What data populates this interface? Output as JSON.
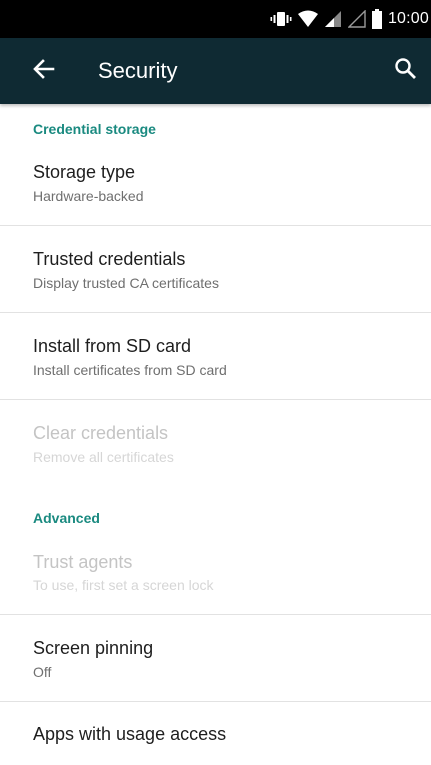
{
  "status_bar": {
    "time": "10:00",
    "icons": [
      "vibrate-icon",
      "wifi-icon",
      "signal-icon",
      "signal-empty-icon",
      "battery-icon"
    ]
  },
  "app_bar": {
    "title": "Security",
    "back_icon": "arrow-back-icon",
    "search_icon": "search-icon",
    "color": "#0f2a33"
  },
  "accent_color": "#1a8a80",
  "sections": [
    {
      "header": "Credential storage",
      "items": [
        {
          "title": "Storage type",
          "summary": "Hardware-backed",
          "enabled": true
        },
        {
          "title": "Trusted credentials",
          "summary": "Display trusted CA certificates",
          "enabled": true
        },
        {
          "title": "Install from SD card",
          "summary": "Install certificates from SD card",
          "enabled": true
        },
        {
          "title": "Clear credentials",
          "summary": "Remove all certificates",
          "enabled": false
        }
      ]
    },
    {
      "header": "Advanced",
      "items": [
        {
          "title": "Trust agents",
          "summary": "To use, first set a screen lock",
          "enabled": false
        },
        {
          "title": "Screen pinning",
          "summary": "Off",
          "enabled": true
        },
        {
          "title": "Apps with usage access",
          "enabled": true
        }
      ]
    }
  ]
}
